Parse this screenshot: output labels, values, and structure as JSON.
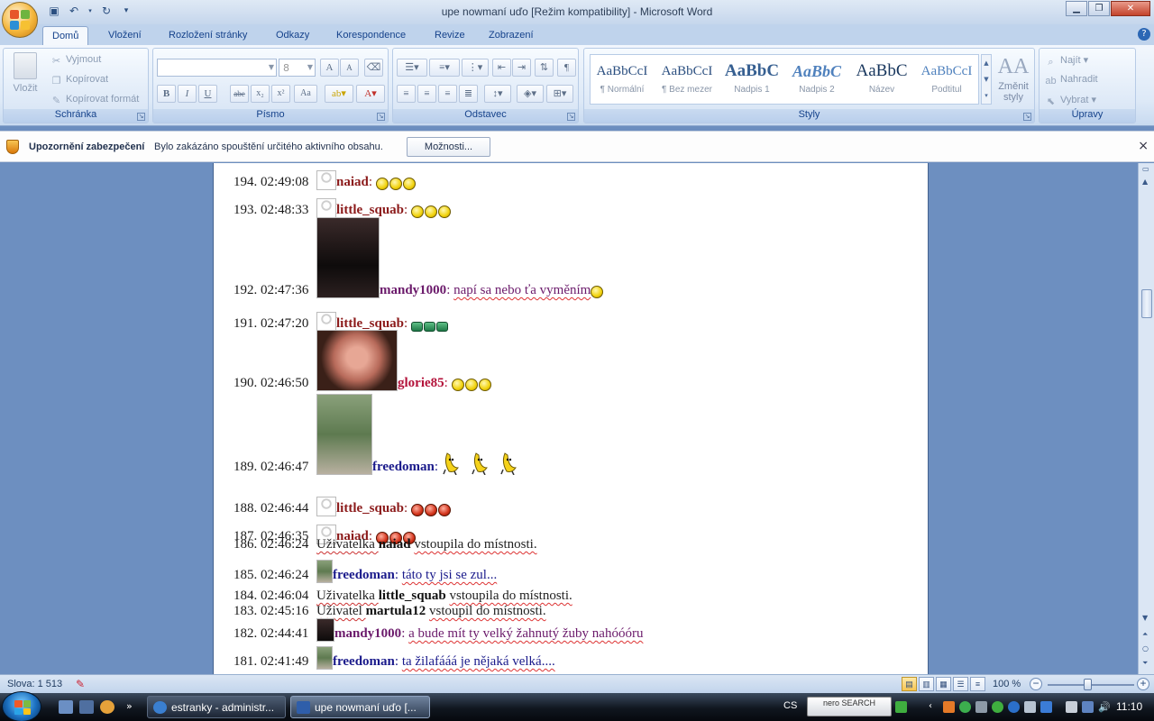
{
  "window": {
    "title": "upe nowmaní uďo [Režim kompatibility] - Microsoft Word",
    "help": "?"
  },
  "ribbon": {
    "tabs": [
      "Domů",
      "Vložení",
      "Rozložení stránky",
      "Odkazy",
      "Korespondence",
      "Revize",
      "Zobrazení"
    ],
    "clipboard": {
      "label": "Schránka",
      "paste": "Vložit",
      "cut": "Vyjmout",
      "copy": "Kopírovat",
      "format_painter": "Kopírovat formát"
    },
    "font": {
      "label": "Písmo",
      "font_name": "",
      "font_size": "8",
      "bold": "B",
      "italic": "I",
      "underline": "U",
      "strike": "abe",
      "subscript": "x₂",
      "superscript": "x²",
      "change_case": "Aa",
      "grow": "A",
      "shrink": "A"
    },
    "paragraph": {
      "label": "Odstavec",
      "pilcrow": "¶"
    },
    "styles": {
      "label": "Styly",
      "items": [
        {
          "sample": "AaBbCcI",
          "name": "¶ Normální"
        },
        {
          "sample": "AaBbCcI",
          "name": "¶ Bez mezer"
        },
        {
          "sample": "AaBbC",
          "name": "Nadpis 1"
        },
        {
          "sample": "AaBbC",
          "name": "Nadpis 2"
        },
        {
          "sample": "AaBbC",
          "name": "Název"
        },
        {
          "sample": "AaBbCcI",
          "name": "Podtitul"
        }
      ],
      "change_styles": "Změnit styly",
      "change_styles_glyph": "AA"
    },
    "editing": {
      "label": "Úpravy",
      "find": "Najít",
      "replace": "Nahradit",
      "select": "Vybrat"
    }
  },
  "security": {
    "title": "Upozornění zabezpečení",
    "text": "Bylo zakázáno spouštění určitého aktivního obsahu.",
    "button": "Možnosti...",
    "close": "×"
  },
  "chat": [
    {
      "meta": "194. 02:49:08",
      "nick": "naiad",
      "nick_color": "#8b1a1a",
      "avatar": "blank",
      "msg": "",
      "emoticons": [
        "yellow",
        "yellow",
        "yellow"
      ]
    },
    {
      "meta": "193. 02:48:33",
      "nick": "little_squab",
      "nick_color": "#8b1a1a",
      "avatar": "blank",
      "msg": "",
      "emoticons": [
        "yellow",
        "yellow",
        "yellow"
      ]
    },
    {
      "meta": "192. 02:47:36",
      "nick": "mandy1000",
      "nick_color": "#6b1a6b",
      "avatar": "dark",
      "msg": "napí sa nebo ťa vyměním",
      "msg_color": "#6b1a6b",
      "emoticons": [
        "yellow"
      ]
    },
    {
      "meta": "191. 02:47:20",
      "nick": "little_squab",
      "nick_color": "#8b1a1a",
      "avatar": "blank",
      "msg": "",
      "emoticons": [
        "green",
        "green",
        "green"
      ]
    },
    {
      "meta": "190. 02:46:50",
      "nick": "glorie85",
      "nick_color": "#b3123a",
      "avatar": "face",
      "msg": "",
      "emoticons": [
        "yellow",
        "yellow",
        "yellow"
      ]
    },
    {
      "meta": "189. 02:46:47",
      "nick": "freedoman",
      "nick_color": "#1a1a8b",
      "avatar": "outdoor",
      "msg": "",
      "emoticons": [
        "banana",
        "banana",
        "banana"
      ]
    },
    {
      "meta": "188. 02:46:44",
      "nick": "little_squab",
      "nick_color": "#8b1a1a",
      "avatar": "blank",
      "msg": "",
      "emoticons": [
        "red",
        "red",
        "red"
      ]
    },
    {
      "meta": "187. 02:46:35",
      "nick": "naiad",
      "nick_color": "#8b1a1a",
      "avatar": "blank",
      "msg": "",
      "emoticons": [
        "red",
        "red",
        "red"
      ]
    },
    {
      "meta": "186. 02:46:24",
      "system": true,
      "pre": "Uživatelka",
      "user": "naiad",
      "post": "vstoupila do místnosti."
    },
    {
      "meta": "185. 02:46:24",
      "nick": "freedoman",
      "nick_color": "#1a1a8b",
      "avatar": "small-outdoor",
      "msg": "táto ty jsi se zul...",
      "msg_color": "#1a1a8b"
    },
    {
      "meta": "184. 02:46:04",
      "system": true,
      "pre": "Uživatelka",
      "user": "little_squab",
      "post": "vstoupila do místnosti."
    },
    {
      "meta": "183. 02:45:16",
      "system": true,
      "pre": "Uživatel",
      "user": "martula12",
      "post": "vstoupil do místnosti."
    },
    {
      "meta": "182. 02:44:41",
      "nick": "mandy1000",
      "nick_color": "#6b1a6b",
      "avatar": "small-dark",
      "msg": "a bude mít ty velký žahnutý žuby nahóóóru",
      "msg_color": "#6b1a6b"
    },
    {
      "meta": "181. 02:41:49",
      "nick": "freedoman",
      "nick_color": "#1a1a8b",
      "avatar": "small-outdoor",
      "msg": "ta žilafááá je nějaká velká....",
      "msg_color": "#1a1a8b"
    }
  ],
  "status": {
    "words": "Slova: 1 513",
    "zoom": "100 %"
  },
  "taskbar": {
    "tasks": [
      {
        "label": "estranky - administr..."
      },
      {
        "label": "upe nowmaní uďo [..."
      }
    ],
    "lang": "CS",
    "nero": "nero SEARCH",
    "clock": "11:10"
  }
}
